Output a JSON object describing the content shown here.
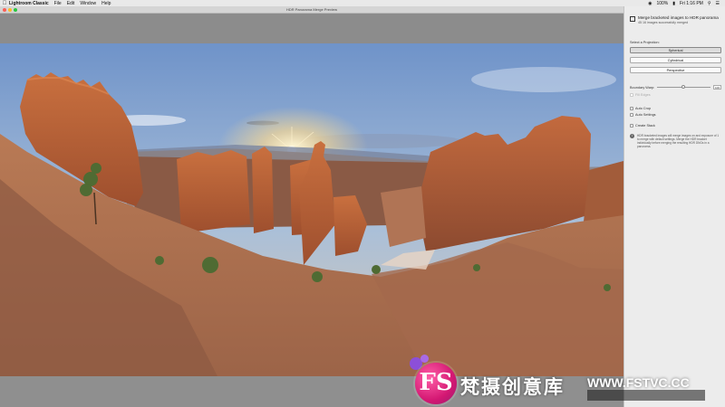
{
  "menubar": {
    "app_name": "Lightroom Classic",
    "menus": [
      "File",
      "Edit",
      "Window",
      "Help"
    ],
    "status": {
      "battery": "100%",
      "time": "Fri 1:16 PM"
    }
  },
  "window": {
    "title": "HDR Panorama Merge Preview"
  },
  "panel": {
    "header_title": "Merge bracketed images to HDR panorama",
    "header_sub": "45 16 images successfully merged",
    "projection_label": "Select a Projection:",
    "projections": [
      "Spherical",
      "Cylindrical",
      "Perspective"
    ],
    "selected_projection": "Spherical",
    "boundary_warp_label": "Boundary Warp:",
    "boundary_warp_value": "100",
    "fill_edges_label": "Fill Edges",
    "auto_crop_label": "Auto Crop",
    "auto_settings_label": "Auto Settings",
    "create_stack_label": "Create Stack",
    "info_text": "HDR bracketed images will merge images on and exposure of 1 to merge with default settings. Merge the HDR bracket individually before merging the resulting HDR DNGs in a panorama."
  },
  "watermark": {
    "logo_text": "FS",
    "cn_text": "梵摄创意库",
    "url_text": "WWW.FSTVC.CC"
  },
  "colors": {
    "accent": "#d41873",
    "panel_bg": "#ececec",
    "canvas_gray": "#8c8c8c"
  }
}
